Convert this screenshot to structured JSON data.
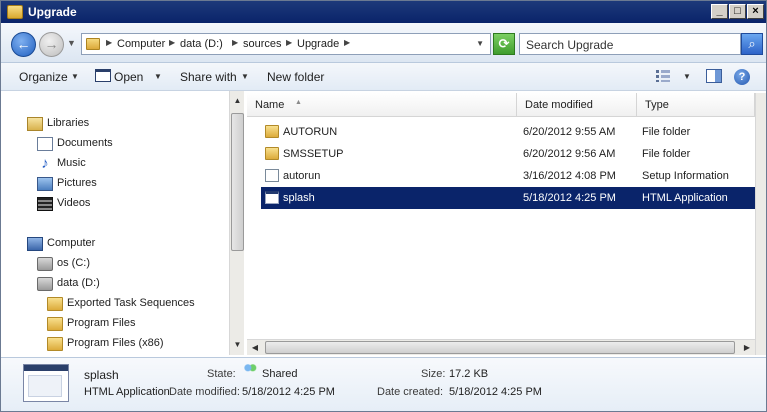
{
  "window": {
    "title": "Upgrade"
  },
  "address": {
    "crumbs": [
      "Computer",
      "data (D:)",
      "sources",
      "Upgrade"
    ],
    "search_placeholder": "Search Upgrade"
  },
  "toolbar": {
    "organize": "Organize",
    "open": "Open",
    "share_with": "Share with",
    "new_folder": "New folder"
  },
  "navpane": {
    "libraries": "Libraries",
    "library_items": [
      "Documents",
      "Music",
      "Pictures",
      "Videos"
    ],
    "computer": "Computer",
    "drives": [
      "os (C:)",
      "data (D:)"
    ],
    "folders": [
      "Exported Task Sequences",
      "Program Files",
      "Program Files (x86)"
    ]
  },
  "columns": {
    "name": "Name",
    "date_modified": "Date modified",
    "type": "Type"
  },
  "files": [
    {
      "name": "AUTORUN",
      "date": "6/20/2012 9:55 AM",
      "type": "File folder",
      "icon": "folder-icon",
      "selected": false
    },
    {
      "name": "SMSSETUP",
      "date": "6/20/2012 9:56 AM",
      "type": "File folder",
      "icon": "folder-icon",
      "selected": false
    },
    {
      "name": "autorun",
      "date": "3/16/2012 4:08 PM",
      "type": "Setup Information",
      "icon": "setup-info-icon",
      "selected": false
    },
    {
      "name": "splash",
      "date": "5/18/2012 4:25 PM",
      "type": "HTML Application",
      "icon": "hta-icon",
      "selected": true
    }
  ],
  "details": {
    "name": "splash",
    "type": "HTML Application",
    "state_label": "State:",
    "state_value": "Shared",
    "size_label": "Size:",
    "size_value": "17.2 KB",
    "date_modified_label": "Date modified:",
    "date_modified_value": "5/18/2012 4:25 PM",
    "date_created_label": "Date created:",
    "date_created_value": "5/18/2012 4:25 PM"
  },
  "colors": {
    "title_bar": "#0a246a",
    "selection": "#0a246a"
  }
}
